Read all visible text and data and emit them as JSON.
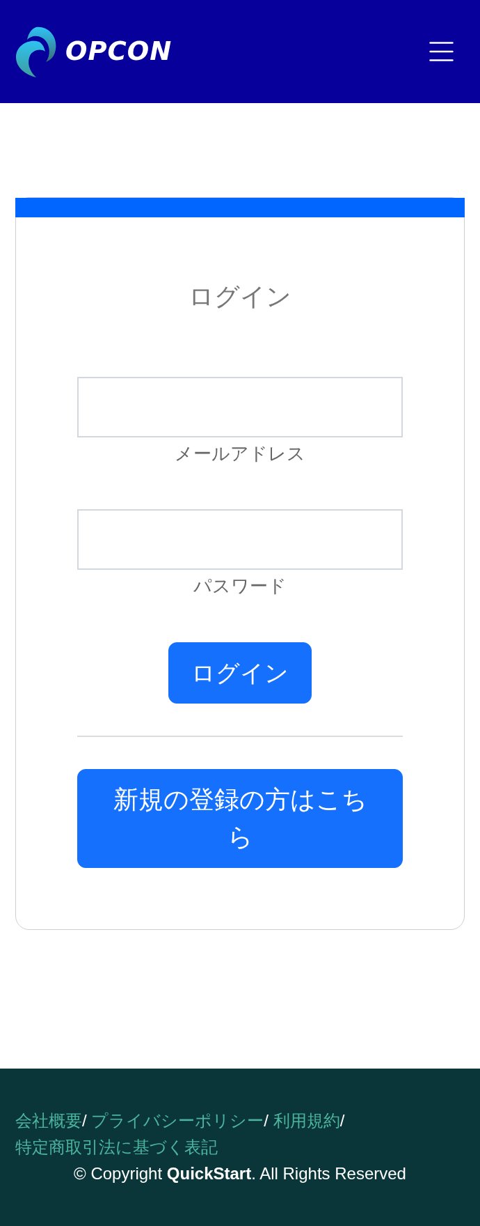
{
  "header": {
    "logo_text": "OPCON"
  },
  "login_card": {
    "title": "ログイン",
    "fields": [
      {
        "label": "メールアドレス"
      },
      {
        "label": "パスワード"
      }
    ],
    "login_button": "ログイン",
    "register_button": "新規の登録の方はこちら"
  },
  "footer": {
    "links": [
      {
        "label": "会社概要",
        "separator": "/"
      },
      {
        "label": "プライバシーポリシー",
        "separator": "/"
      },
      {
        "label": "利用規約",
        "separator": "/"
      },
      {
        "label": "特定商取引法に基づく表記"
      }
    ],
    "copyright": "© Copyright **QuickStart**. All Rights Reserved"
  }
}
